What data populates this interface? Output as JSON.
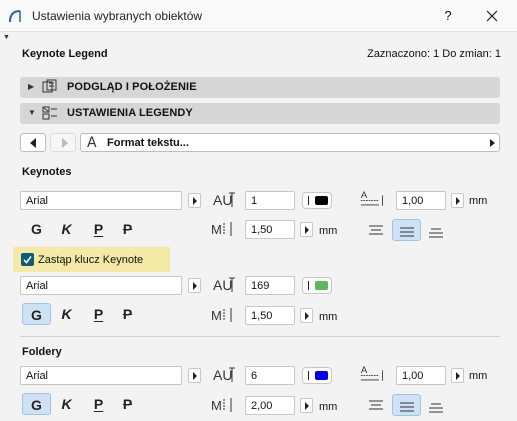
{
  "window": {
    "title": "Ustawienia wybranych obiektów",
    "help": "?",
    "dialog_name": "Keynote Legend",
    "selection_info": "Zaznaczono: 1 Do zmian: 1"
  },
  "sections": [
    {
      "label": "PODGLĄD I POŁOŻENIE",
      "expanded": false,
      "icon": "preview-icon"
    },
    {
      "label": "USTAWIENIA LEGENDY",
      "expanded": true,
      "icon": "legend-settings-icon"
    }
  ],
  "nav": {
    "page_label": "Format tekstu...",
    "page_icon": "text-format-icon"
  },
  "groups": {
    "keynotes": {
      "title": "Keynotes",
      "font": "Arial",
      "spacing": "1",
      "size": "1,50",
      "line_spacing": "1,00",
      "color": "#000000",
      "unit_size": "mm",
      "unit_line": "mm",
      "styles": [
        "G",
        "K",
        "P",
        "P"
      ],
      "bold_active": false,
      "alignment_active": "center"
    },
    "override": {
      "label": "Zastąp klucz Keynote",
      "checked": true,
      "font": "Arial",
      "spacing": "169",
      "size": "1,50",
      "color": "#5cb85c",
      "unit_size": "mm",
      "styles": [
        "G",
        "K",
        "P",
        "P"
      ],
      "bold_active": true
    },
    "folders": {
      "title": "Foldery",
      "font": "Arial",
      "spacing": "6",
      "size": "2,00",
      "line_spacing": "1,00",
      "color": "#0000ee",
      "unit_size": "mm",
      "unit_line": "mm",
      "styles": [
        "G",
        "K",
        "P",
        "P"
      ],
      "bold_active": true,
      "alignment_active": "center"
    }
  }
}
